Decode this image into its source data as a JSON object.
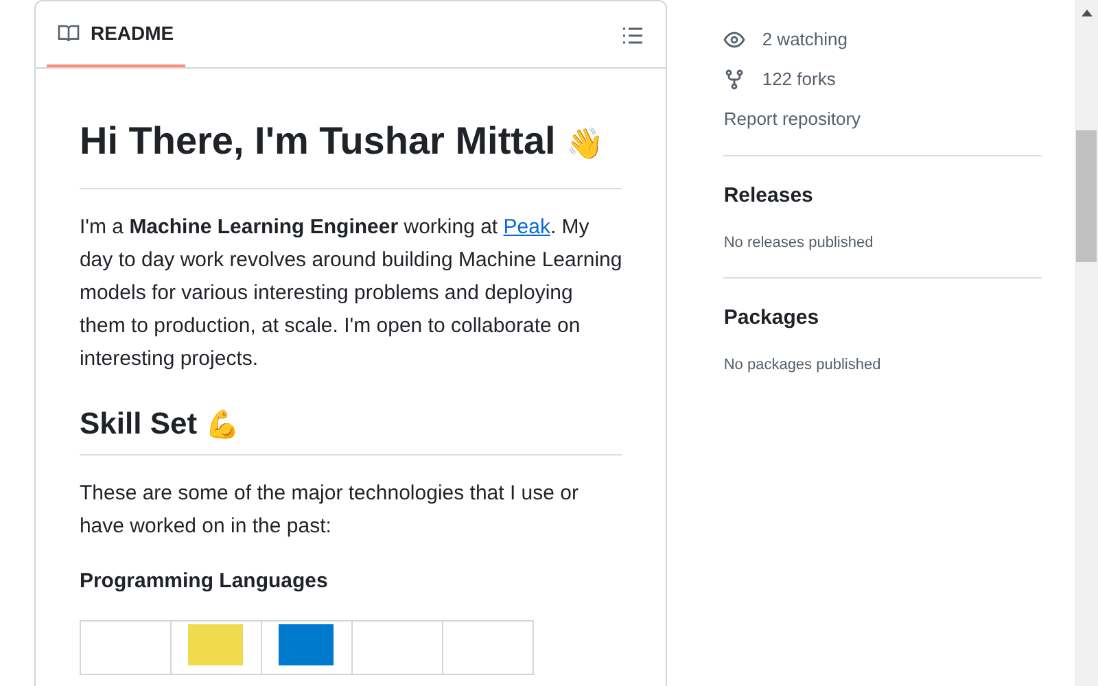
{
  "readme": {
    "tab": {
      "label": "README",
      "selected": true
    },
    "title": "Hi There, I'm Tushar Mittal",
    "title_emoji": "👋",
    "intro": {
      "before": "I'm a **Machine Learning Engineer** working at ",
      "link": "Peak",
      "after": ". My day to day work revolves around building Machine Learning models for various interesting problems and deploying them to production, at scale. I'm open to collaborate on interesting projects."
    },
    "skills_heading": "Skill Set",
    "skills_emoji": "💪",
    "skills_text": "These are some of the major technologies that I use or have worked on in the past:",
    "languages_heading": "Programming Languages",
    "language_cells": [
      {
        "kind": "blank"
      },
      {
        "kind": "logo",
        "color": "#f0db4f"
      },
      {
        "kind": "logo",
        "color": "#007acc"
      },
      {
        "kind": "blank"
      },
      {
        "kind": "blank"
      }
    ]
  },
  "sidebar": {
    "stats": [
      {
        "kind": "watch",
        "label": "2 watching"
      },
      {
        "kind": "fork",
        "label": "122 forks"
      }
    ],
    "report": "Report repository",
    "sections": [
      {
        "title": "Releases",
        "note": "No releases published"
      },
      {
        "title": "Packages",
        "note": "No packages published"
      }
    ]
  }
}
